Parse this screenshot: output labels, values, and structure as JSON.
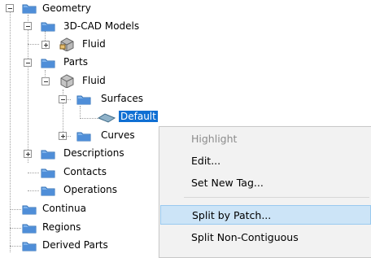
{
  "tree": {
    "geometry": "Geometry",
    "cad_models": "3D-CAD Models",
    "fluid_cad": "Fluid",
    "parts": "Parts",
    "fluid_part": "Fluid",
    "surfaces": "Surfaces",
    "default": "Default",
    "curves": "Curves",
    "descriptions": "Descriptions",
    "contacts": "Contacts",
    "operations": "Operations",
    "continua": "Continua",
    "regions": "Regions",
    "derived_parts": "Derived Parts"
  },
  "context_menu": {
    "items": [
      "Highlight",
      "Edit...",
      "Set New Tag...",
      "Split by Patch...",
      "Split Non-Contiguous"
    ]
  },
  "colors": {
    "selection": "#0f6fd3",
    "menu_highlight": "#cce4f7",
    "folder": "#4f8ed8"
  }
}
